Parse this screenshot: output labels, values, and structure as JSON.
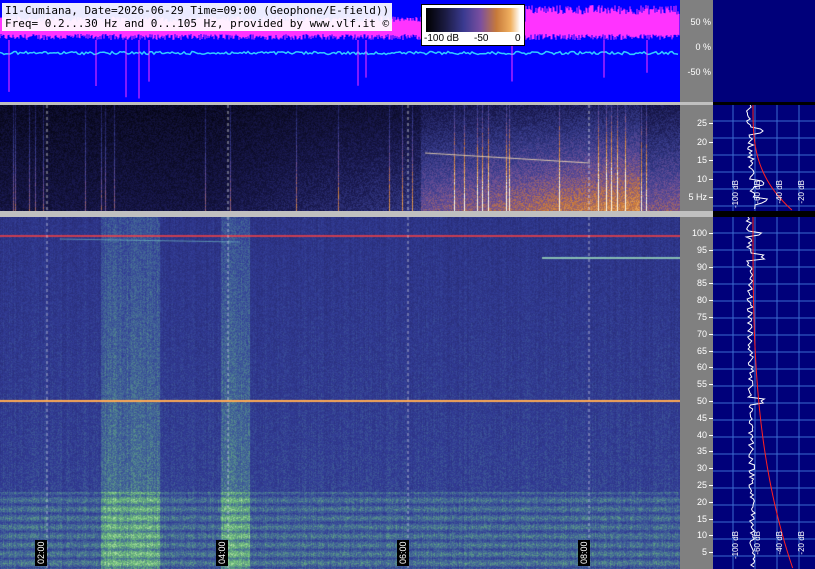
{
  "header": {
    "line1": "I1-Cumiana, Date=2026-06-29 Time=09:00 (Geophone/E-field))",
    "line2": "Freq= 0.2...30 Hz and 0...105 Hz, provided by www.vlf.it ©"
  },
  "colorbar": {
    "ticks": [
      "-100 dB",
      "-50",
      "0"
    ]
  },
  "waveform_scale": [
    "50 %",
    "0 %",
    "-50 %"
  ],
  "low_band_scale": [
    "25",
    "20",
    "15",
    "10",
    "5 Hz"
  ],
  "high_band_scale": [
    "100",
    "95",
    "90",
    "85",
    "80",
    "75",
    "70",
    "65",
    "60",
    "55",
    "50",
    "45",
    "40",
    "35",
    "30",
    "25",
    "20",
    "15",
    "10",
    "5"
  ],
  "time_labels": [
    "02:00",
    "04:00",
    "06:00",
    "08:00"
  ],
  "side_db_labels_low": [
    "-100 dB",
    "-60 dB",
    "-40 dB",
    "-20 dB"
  ],
  "side_db_labels_high": [
    "-100 dB",
    "-60 dB",
    "-40 dB",
    "-20 dB"
  ],
  "colors": {
    "waveform_bg": "#0000ff",
    "waveform_trace": "#ff33ff",
    "zero_trace": "#33ccff",
    "side_bg": "#00007a",
    "scale_bg": "#808080",
    "mains_line": "#ff4040"
  }
}
